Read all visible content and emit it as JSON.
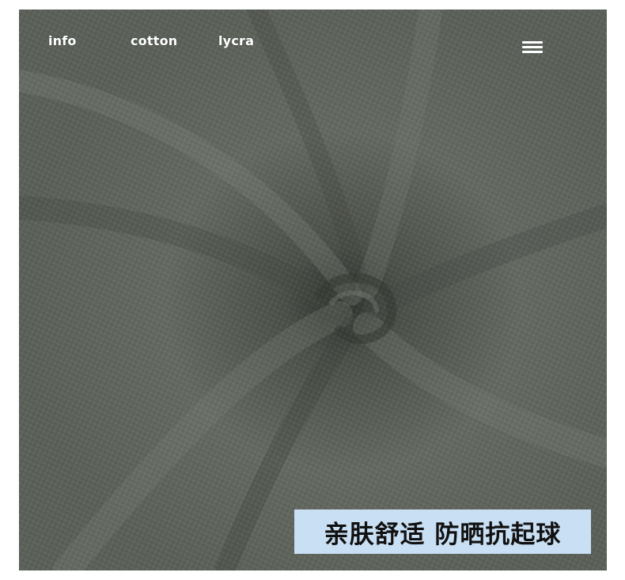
{
  "nav": {
    "items": [
      {
        "label": "info"
      },
      {
        "label": "cotton"
      },
      {
        "label": "lycra"
      }
    ]
  },
  "menu": {
    "icon": "hamburger-menu-icon"
  },
  "caption": {
    "text": "亲肤舒适 防晒抗起球"
  },
  "colors": {
    "fabric": "#5e645c",
    "caption_background": "#c9dff3",
    "nav_text": "#ffffff",
    "caption_text": "#111111"
  }
}
